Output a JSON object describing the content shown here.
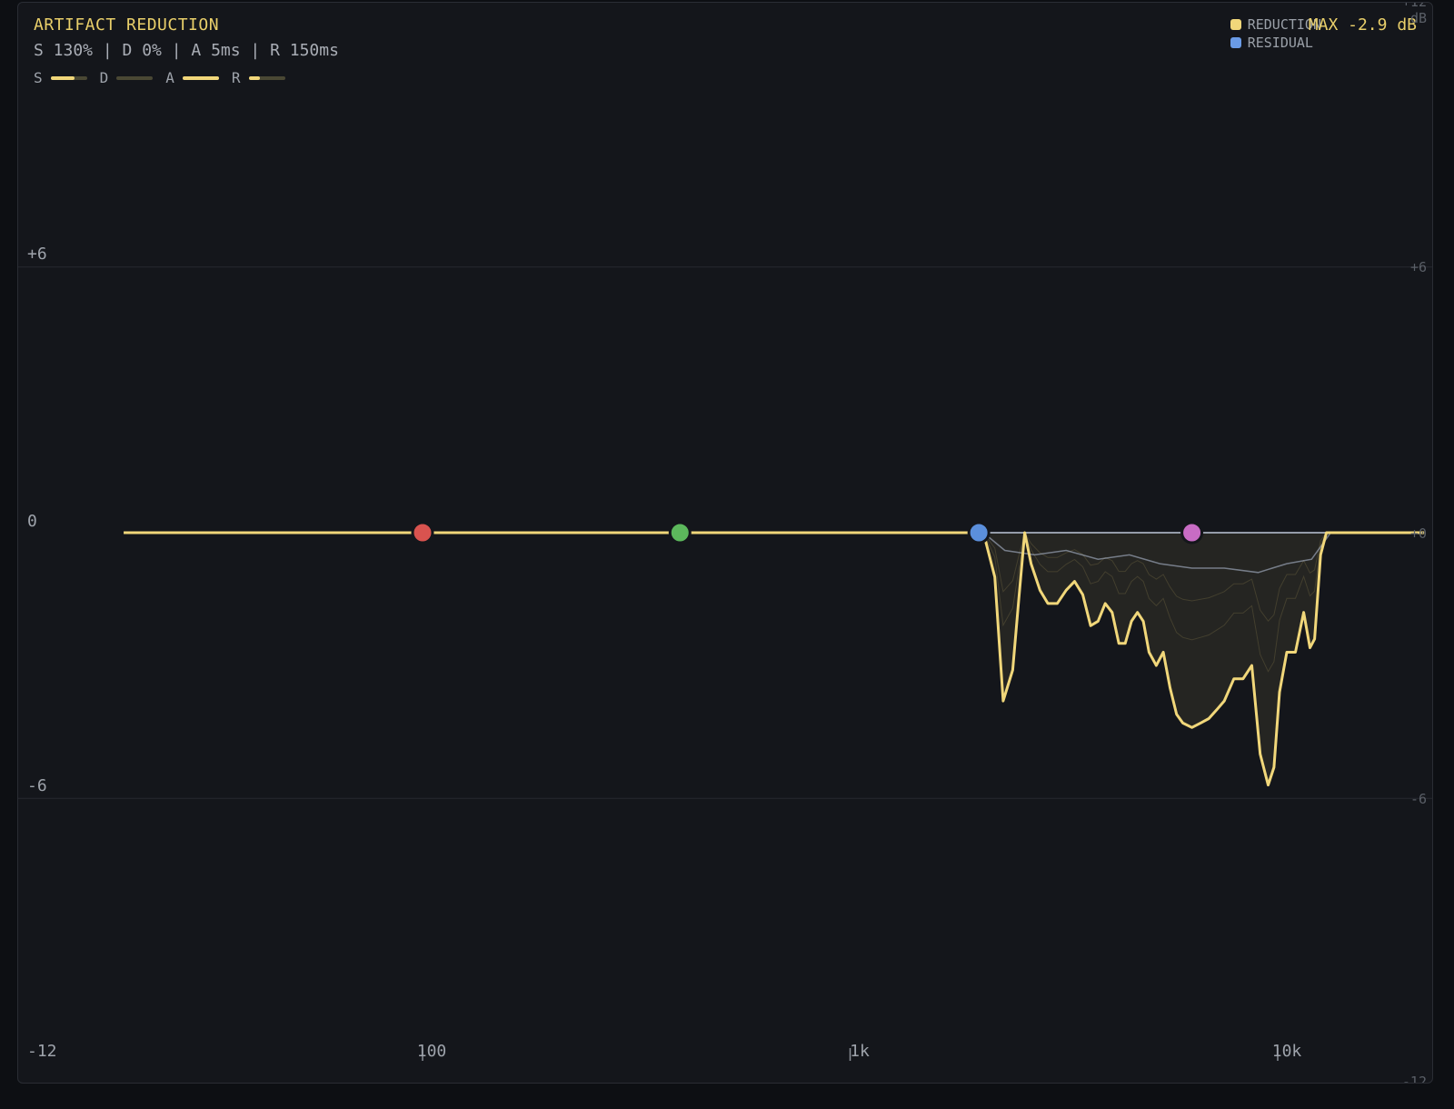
{
  "header": {
    "title": "ARTIFACT REDUCTION",
    "params": "S 130% | D 0% | A 5ms | R 150ms",
    "meters": [
      {
        "label": "S",
        "level": 0.65
      },
      {
        "label": "D",
        "level": 0.0
      },
      {
        "label": "A",
        "level": 1.0
      },
      {
        "label": "R",
        "level": 0.3
      }
    ],
    "max_readout": "MAX -2.9 dB"
  },
  "legend": [
    {
      "label": "REDUCTION",
      "color": "#f1d77a"
    },
    {
      "label": "RESIDUAL",
      "color": "#6a9be6"
    }
  ],
  "colors": {
    "accent": "#e9cf6a",
    "reduction": "#f1d77a",
    "residual": "#b9c7df",
    "background": "#14161b"
  },
  "chart_data": {
    "type": "line",
    "xscale": "log",
    "xlim": [
      20,
      22000
    ],
    "ylim": [
      -12,
      12
    ],
    "grid": true,
    "y_ticks_left": [
      "+6",
      "0",
      "-6",
      "-12"
    ],
    "y_ticks_right": [
      "+12",
      "dB",
      "+6",
      "+0",
      "-6",
      "-12"
    ],
    "x_ticks": [
      "100",
      "1k",
      "10k"
    ],
    "nodes": [
      {
        "freq": 100,
        "color": "#d9534f"
      },
      {
        "freq": 400,
        "color": "#5cb85c"
      },
      {
        "freq": 2000,
        "color": "#5b8fdc"
      },
      {
        "freq": 6300,
        "color": "#c86cc4"
      }
    ],
    "series": [
      {
        "name": "REDUCTION",
        "x": [
          20,
          2050,
          2180,
          2280,
          2400,
          2480,
          2560,
          2650,
          2780,
          2900,
          3050,
          3200,
          3350,
          3500,
          3650,
          3800,
          3950,
          4100,
          4250,
          4400,
          4550,
          4700,
          4850,
          5000,
          5200,
          5400,
          5600,
          5800,
          6000,
          6300,
          6600,
          6900,
          7200,
          7500,
          7900,
          8300,
          8700,
          9100,
          9500,
          9800,
          10100,
          10500,
          11000,
          11500,
          11900,
          12200,
          12600,
          13000,
          13300,
          22000
        ],
        "y": [
          0,
          0,
          -1.0,
          -3.8,
          -3.1,
          -1.5,
          0,
          -0.7,
          -1.3,
          -1.6,
          -1.6,
          -1.3,
          -1.1,
          -1.4,
          -2.1,
          -2.0,
          -1.6,
          -1.8,
          -2.5,
          -2.5,
          -2.0,
          -1.8,
          -2.0,
          -2.7,
          -3.0,
          -2.7,
          -3.5,
          -4.1,
          -4.3,
          -4.4,
          -4.3,
          -4.2,
          -4.0,
          -3.8,
          -3.3,
          -3.3,
          -3.0,
          -5.0,
          -5.7,
          -5.3,
          -3.6,
          -2.7,
          -2.7,
          -1.8,
          -2.6,
          -2.4,
          -0.5,
          0,
          0,
          0
        ]
      },
      {
        "name": "RESIDUAL",
        "x": [
          20,
          2050,
          2300,
          2700,
          3200,
          3800,
          4500,
          5300,
          6300,
          7500,
          9000,
          10500,
          12000,
          13300,
          22000
        ],
        "y": [
          0,
          0,
          -0.4,
          -0.5,
          -0.4,
          -0.6,
          -0.5,
          -0.7,
          -0.8,
          -0.8,
          -0.9,
          -0.7,
          -0.6,
          0,
          0
        ]
      }
    ]
  }
}
